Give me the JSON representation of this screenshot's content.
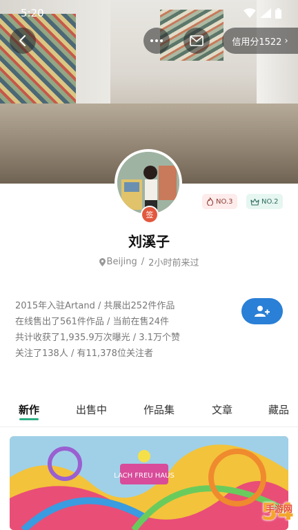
{
  "status_bar": {
    "time": "5:20"
  },
  "header": {
    "credit_label": "信用分1522",
    "credit_arrow": "›"
  },
  "profile": {
    "name": "刘溪子",
    "badge": "签",
    "location": "Beijing",
    "separator": "/",
    "last_seen": "2小时前来过",
    "rank_heat": "NO.3",
    "rank_gift": "NO.2"
  },
  "stats": {
    "line1": "2015年入驻Artand / 共展出252件作品",
    "line2": "在线售出了561件作品 / 当前在售24件",
    "line3": "共计收获了1,935.9万次曝光 / 3.1万个赞",
    "line4": "关注了138人 / 有11,378位关注者"
  },
  "tabs": [
    {
      "label": "新作",
      "active": true
    },
    {
      "label": "出售中",
      "active": false
    },
    {
      "label": "作品集",
      "active": false
    },
    {
      "label": "文章",
      "active": false
    },
    {
      "label": "藏品",
      "active": false
    }
  ],
  "artwork": {
    "sign_text": "LACH FREU HAUS"
  },
  "watermark": {
    "main": "54",
    "sub": "手游网"
  },
  "colors": {
    "accent": "#2eae84",
    "follow_button": "#2a7fd6",
    "badge": "#e2583e"
  },
  "icons": [
    "back-icon",
    "more-icon",
    "mail-icon",
    "location-pin-icon",
    "add-user-icon",
    "flame-icon",
    "crown-icon",
    "wifi-icon",
    "signal-icon",
    "battery-icon"
  ]
}
